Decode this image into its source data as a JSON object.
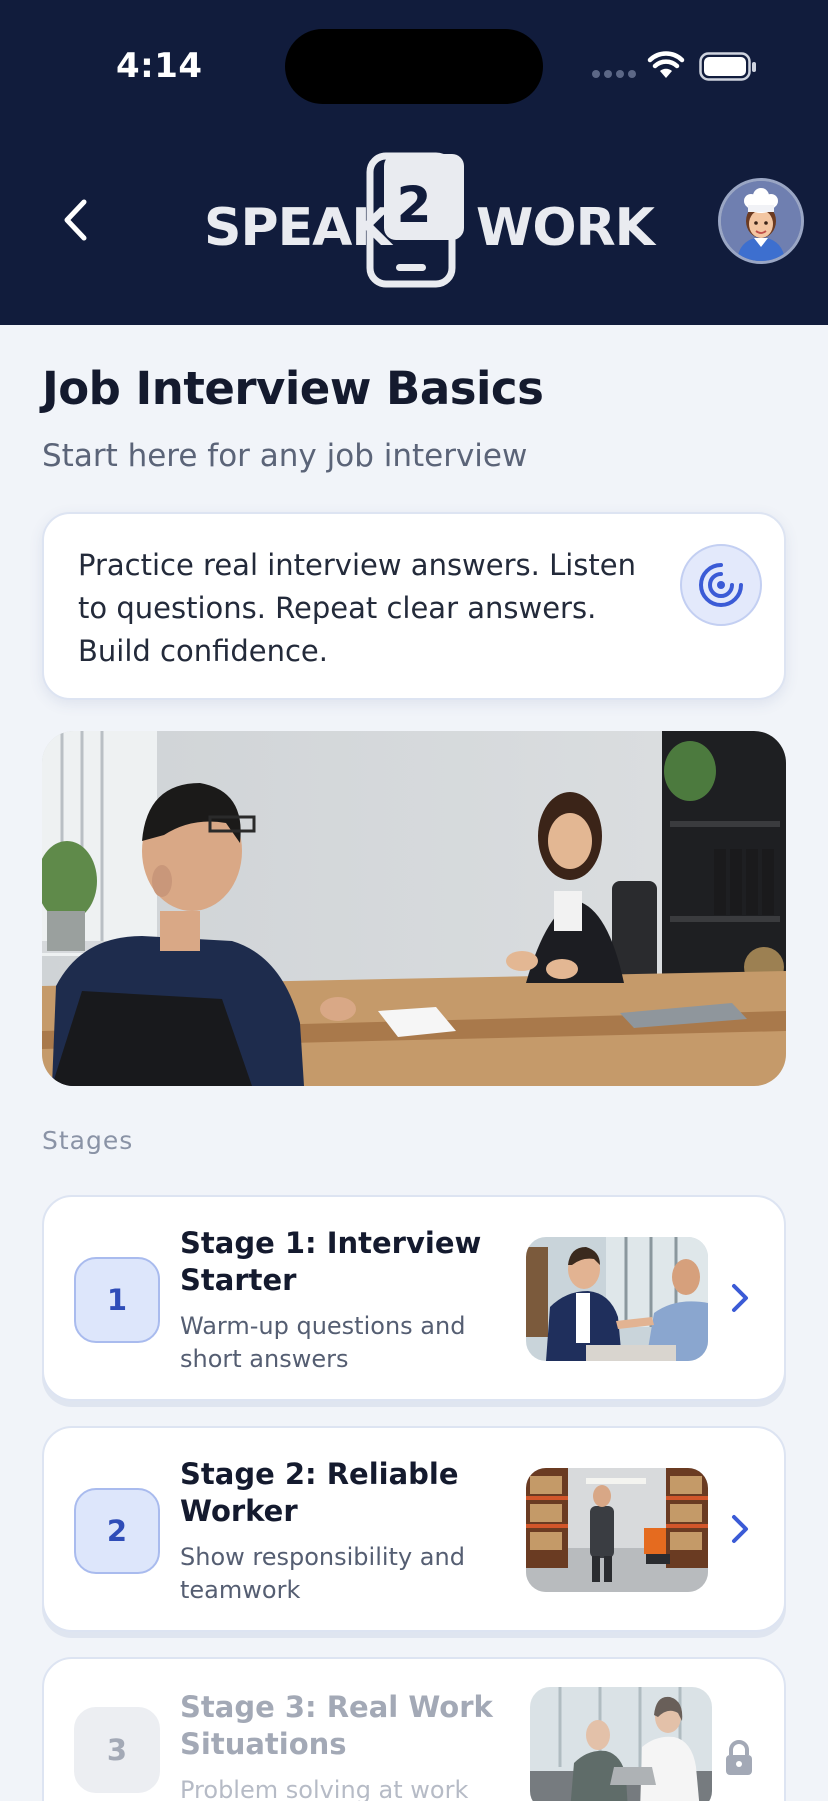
{
  "status_bar": {
    "time": "4:14"
  },
  "header": {
    "logo_left": "SPEAK",
    "logo_number": "2",
    "logo_right": "WORK"
  },
  "page": {
    "title": "Job Interview Basics",
    "subtitle": "Start here for any job interview"
  },
  "info_card": {
    "text": "Practice real interview answers. Listen to questions. Repeat clear answers. Build confidence."
  },
  "stages_label": "Stages",
  "stages": [
    {
      "number": "1",
      "title": "Stage 1: Interview Starter",
      "description": "Warm-up questions and short answers",
      "locked": false
    },
    {
      "number": "2",
      "title": "Stage 2: Reliable Worker",
      "description": "Show responsibility and teamwork",
      "locked": false
    },
    {
      "number": "3",
      "title": "Stage 3: Real Work Situations",
      "description": "Problem solving at work",
      "locked": true
    }
  ],
  "icons": {
    "back": "chevron-left-icon",
    "audio": "audio-waves-icon",
    "chevron": "chevron-right-icon",
    "lock": "lock-icon"
  },
  "colors": {
    "header_bg": "#111c3c",
    "accent": "#2f4db8",
    "page_bg": "#f1f4f9"
  }
}
